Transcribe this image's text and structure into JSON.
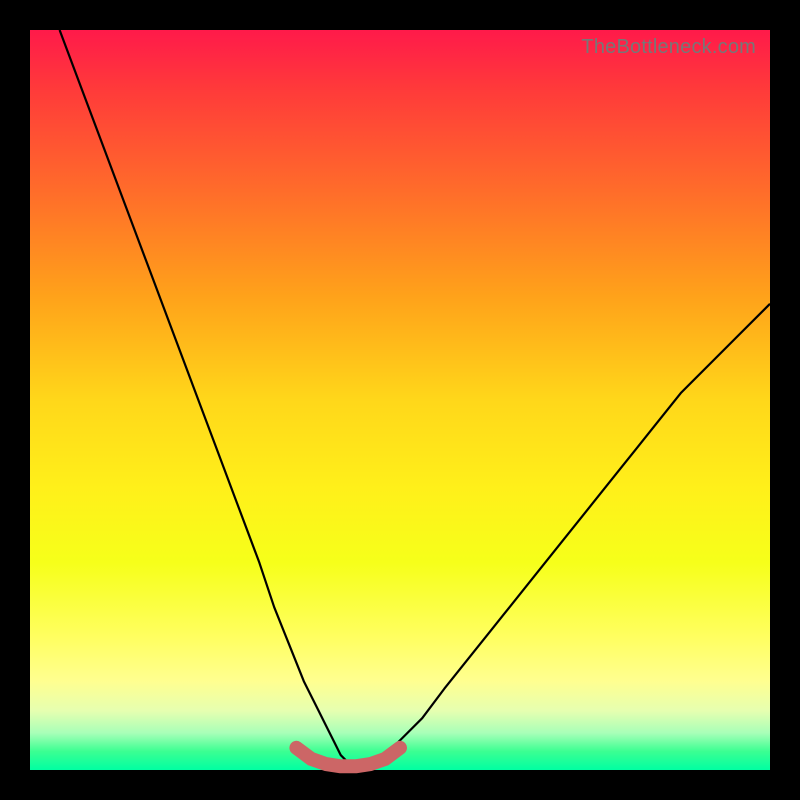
{
  "watermark": "TheBottleneck.com",
  "colors": {
    "frame": "#000000",
    "gradient_top": "#ff1a4a",
    "gradient_bottom": "#00ffa2",
    "curve": "#000000",
    "bottom_mark": "#cc6666"
  },
  "chart_data": {
    "type": "line",
    "title": "",
    "xlabel": "",
    "ylabel": "",
    "xlim": [
      0,
      100
    ],
    "ylim": [
      0,
      100
    ],
    "series": [
      {
        "name": "main-curve",
        "x": [
          4,
          7,
          10,
          13,
          16,
          19,
          22,
          25,
          28,
          31,
          33,
          35,
          37,
          39,
          40,
          41,
          42,
          43,
          44,
          45,
          46,
          48,
          50,
          53,
          56,
          60,
          64,
          68,
          72,
          76,
          80,
          84,
          88,
          92,
          96,
          100
        ],
        "y": [
          100,
          92,
          84,
          76,
          68,
          60,
          52,
          44,
          36,
          28,
          22,
          17,
          12,
          8,
          6,
          4,
          2,
          1,
          0.5,
          0.5,
          1,
          2,
          4,
          7,
          11,
          16,
          21,
          26,
          31,
          36,
          41,
          46,
          51,
          55,
          59,
          63
        ]
      },
      {
        "name": "bottom-flat-marker",
        "x": [
          36,
          38,
          40,
          42,
          44,
          46,
          48,
          50
        ],
        "y": [
          3,
          1.5,
          0.8,
          0.5,
          0.5,
          0.8,
          1.5,
          3
        ]
      }
    ]
  }
}
